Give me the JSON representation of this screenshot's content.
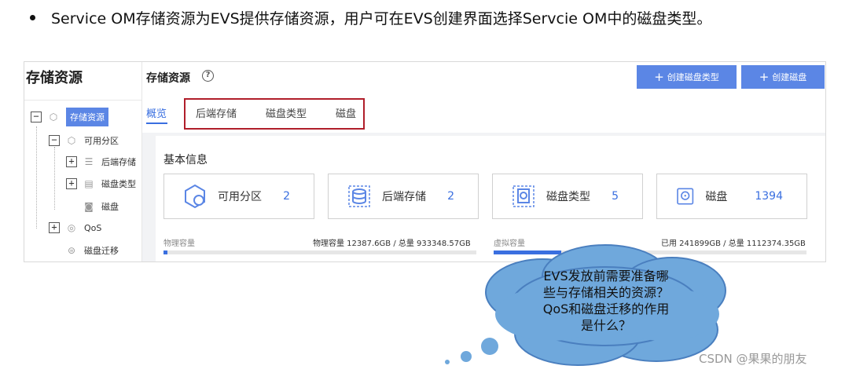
{
  "slide": {
    "bullet_text": "Service OM存储资源为EVS提供存储资源，用户可在EVS创建界面选择Servcie OM中的磁盘类型。"
  },
  "sidebar": {
    "title": "存储资源",
    "tree": [
      {
        "label": "存储资源",
        "toggle": "−",
        "icon": "hexagon-icon",
        "selected": true
      },
      {
        "label": "可用分区",
        "toggle": "−",
        "icon": "hexagon-icon"
      },
      {
        "label": "后端存储",
        "toggle": "+",
        "icon": "storage-icon"
      },
      {
        "label": "磁盘类型",
        "toggle": "+",
        "icon": "disk-type-icon"
      },
      {
        "label": "磁盘",
        "toggle": "",
        "icon": "disk-icon"
      },
      {
        "label": "QoS",
        "toggle": "+",
        "icon": "qos-icon"
      },
      {
        "label": "磁盘迁移",
        "toggle": "",
        "icon": "migrate-icon"
      }
    ]
  },
  "header": {
    "title": "存储资源",
    "help_icon": "?",
    "buttons": {
      "create_disk_type": "创建磁盘类型",
      "create_disk": "创建磁盘",
      "plus": "+"
    }
  },
  "tabs": [
    {
      "label": "概览",
      "active": true
    },
    {
      "label": "后端存储"
    },
    {
      "label": "磁盘类型"
    },
    {
      "label": "磁盘"
    }
  ],
  "basic_info": {
    "title": "基本信息",
    "stats": [
      {
        "label": "可用分区",
        "value": "2",
        "icon": "zone-icon"
      },
      {
        "label": "后端存储",
        "value": "2",
        "icon": "backend-storage-icon"
      },
      {
        "label": "磁盘类型",
        "value": "5",
        "icon": "disk-type-icon"
      },
      {
        "label": "磁盘",
        "value": "1394",
        "icon": "disk-icon"
      }
    ],
    "physical": {
      "label": "物理容量",
      "value_text": "物理容量 12387.6GB / 总量 933348.57GB",
      "fraction": 0.013
    },
    "virtual": {
      "label": "虚拟容量",
      "value_text": "已用 241899GB / 总量 1112374.35GB",
      "fraction": 0.217
    }
  },
  "callout": {
    "lines": [
      "EVS发放前需要准备哪",
      "些与存储相关的资源？",
      "QoS和磁盘迁移的作用",
      "是什么？"
    ],
    "fill": "#6fa8dc"
  },
  "watermark": "CSDN @果果的朋友"
}
